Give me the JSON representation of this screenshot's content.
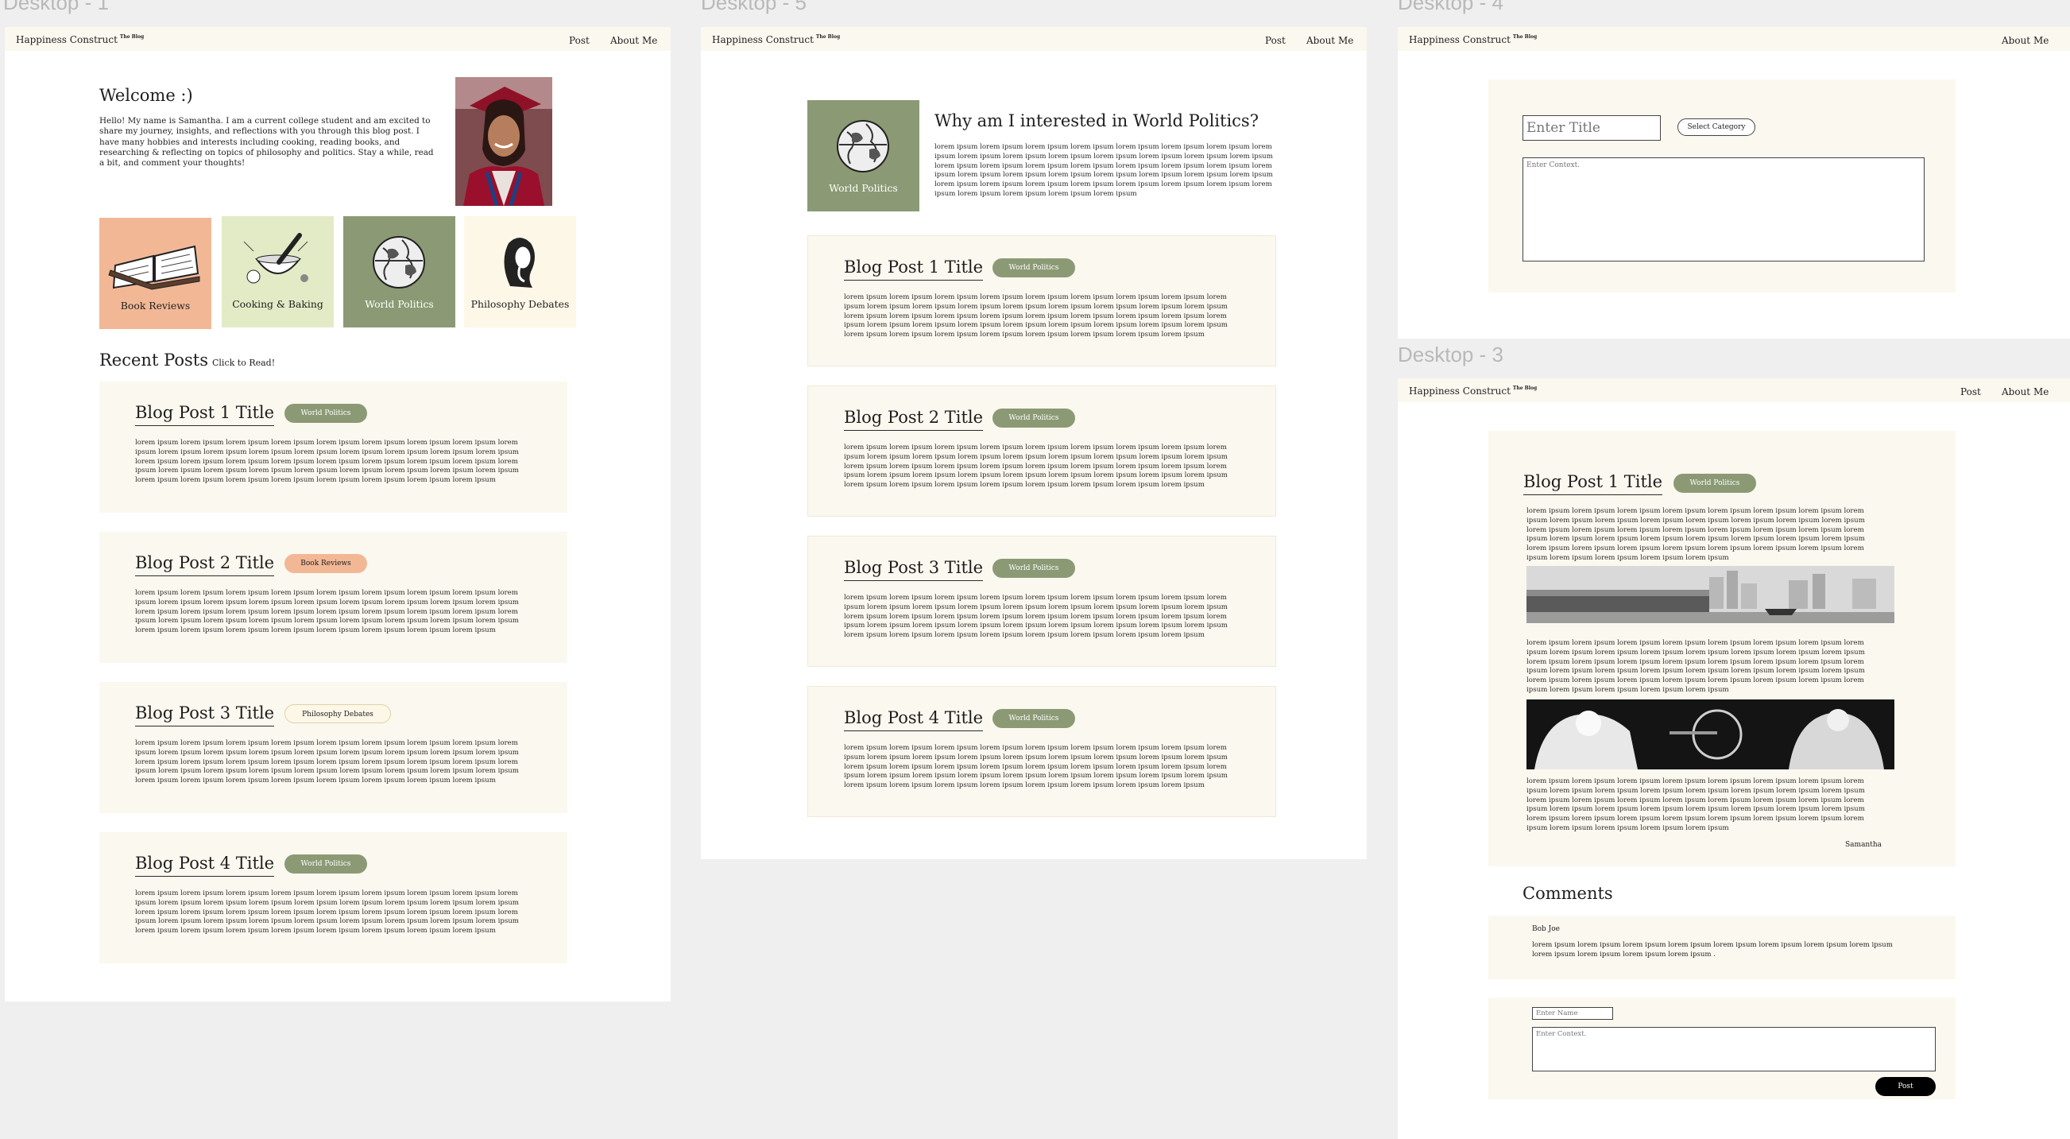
{
  "canvas": {
    "labels": [
      "Desktop - 1",
      "Desktop - 5",
      "Desktop - 4",
      "Desktop - 3"
    ]
  },
  "nav": {
    "brand": "Happiness Construct",
    "brand_sup": "The Blog",
    "post": "Post",
    "about": "About Me"
  },
  "colors": {
    "accent_green": "#8b9a74",
    "peach": "#f2b896",
    "cream": "#fbf8ef",
    "pale_green": "#e3ebc6",
    "pale_yellow": "#fdf7e7"
  },
  "home": {
    "welcome": "Welcome :)",
    "intro": "Hello! My name is Samantha. I am a current college student and am excited to share my journey, insights, and reflections with you through this blog post. I have many hobbies and interests including cooking, reading books, and researching & reflecting on topics of philosophy and politics. Stay a while, read a bit, and comment your thoughts!",
    "categories": [
      {
        "label": "Book Reviews",
        "icon": "book-icon"
      },
      {
        "label": "Cooking & Baking",
        "icon": "mortar-pestle-icon"
      },
      {
        "label": "World Politics",
        "icon": "globe-icon"
      },
      {
        "label": "Philosophy Debates",
        "icon": "thinker-icon"
      }
    ],
    "recent_title": "Recent Posts",
    "click_to_read": "Click to Read!",
    "posts": [
      {
        "title": "Blog Post 1 Title",
        "tag": "World Politics"
      },
      {
        "title": "Blog Post 2 Title",
        "tag": "Book Reviews"
      },
      {
        "title": "Blog Post 3 Title",
        "tag": "Philosophy Debates"
      },
      {
        "title": "Blog Post 4 Title",
        "tag": "World Politics"
      }
    ]
  },
  "lorem_block": "lorem ipsum lorem ipsum lorem ipsum lorem ipsum lorem ipsum lorem ipsum lorem ipsum lorem ipsum lorem ipsum lorem ipsum lorem ipsum lorem ipsum lorem ipsum lorem ipsum lorem ipsum lorem ipsum lorem ipsum lorem ipsum lorem ipsum lorem ipsum lorem ipsum lorem ipsum lorem ipsum lorem ipsum lorem ipsum lorem ipsum lorem ipsum lorem ipsum lorem ipsum lorem ipsum lorem ipsum lorem ipsum lorem ipsum lorem ipsum lorem ipsum lorem ipsum lorem ipsum lorem ipsum lorem ipsum lorem ipsum lorem ipsum lorem ipsum",
  "category_page": {
    "category_label": "World Politics",
    "heading": "Why am I interested in World Politics?",
    "posts": [
      {
        "title": "Blog Post 1 Title",
        "tag": "World Politics"
      },
      {
        "title": "Blog Post 2 Title",
        "tag": "World Politics"
      },
      {
        "title": "Blog Post 3 Title",
        "tag": "World Politics"
      },
      {
        "title": "Blog Post 4 Title",
        "tag": "World Politics"
      }
    ]
  },
  "new_post": {
    "title_placeholder": "Enter Title",
    "category_button": "Select Category",
    "content_placeholder": "Enter Context."
  },
  "post_page": {
    "title": "Blog Post 1 Title",
    "tag": "World Politics",
    "author": "Samantha",
    "comments_title": "Comments",
    "comment": {
      "name": "Bob Joe",
      "text": "lorem ipsum lorem ipsum lorem ipsum lorem ipsum lorem ipsum lorem ipsum lorem ipsum lorem ipsum lorem ipsum lorem ipsum lorem ipsum lorem ipsum ."
    },
    "form": {
      "name_placeholder": "Enter Name",
      "content_placeholder": "Enter Context.",
      "submit": "Post"
    }
  }
}
